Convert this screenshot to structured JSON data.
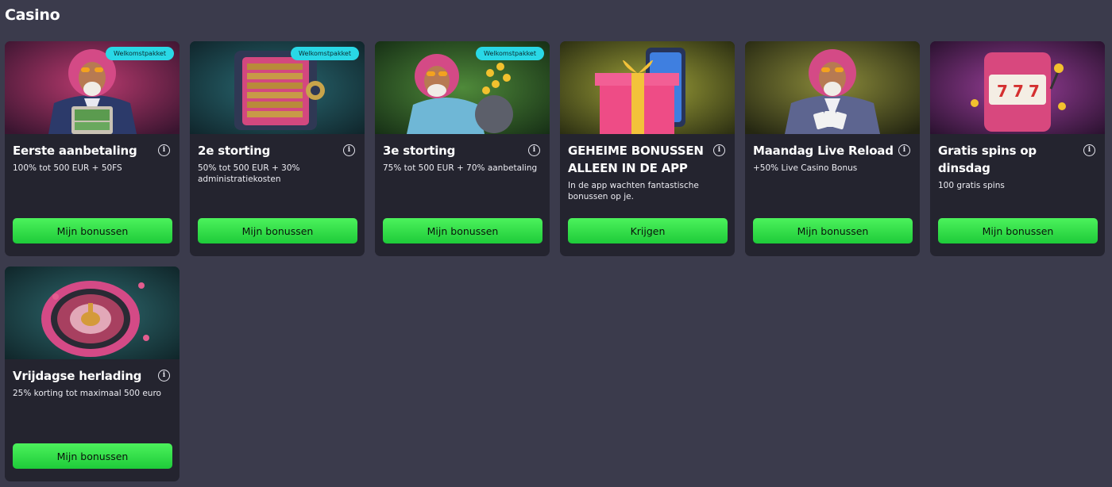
{
  "page": {
    "title": "Casino"
  },
  "cards": [
    {
      "title": "Eerste aanbetaling",
      "description": "100% tot 500 EUR + 50FS",
      "badge": "Welkomstpakket",
      "button": "Mijn bonussen",
      "image": "lion-with-money-briefcase-image"
    },
    {
      "title": "2e storting",
      "description": "50% tot 500 EUR + 30% administratiekosten",
      "badge": "Welkomstpakket",
      "button": "Mijn bonussen",
      "image": "open-safe-image"
    },
    {
      "title": "3e storting",
      "description": "75% tot 500 EUR + 70% aanbetaling",
      "badge": "Welkomstpakket",
      "button": "Mijn bonussen",
      "image": "lion-with-coin-bag-image"
    },
    {
      "title": "GEHEIME BONUSSEN ALLEEN IN DE APP",
      "description": "In de app wachten fantastische bonussen op je.",
      "badge": "",
      "button": "Krijgen",
      "image": "gift-and-phone-image"
    },
    {
      "title": "Maandag Live Reload",
      "description": "+50% Live Casino Bonus",
      "badge": "",
      "button": "Mijn bonussen",
      "image": "lion-with-cards-image"
    },
    {
      "title": "Gratis spins op dinsdag",
      "description": "100 gratis spins",
      "badge": "",
      "button": "Mijn bonussen",
      "image": "slot-machine-image"
    },
    {
      "title": "Vrijdagse herlading",
      "description": "25% korting tot maximaal 500 euro",
      "badge": "",
      "button": "Mijn bonussen",
      "image": "roulette-wheel-image"
    }
  ],
  "icons": {
    "info": "info-icon"
  },
  "colors": {
    "background": "#3b3b4c",
    "card": "#24242f",
    "button": "#2ee04a",
    "badge": "#29d8e6"
  }
}
